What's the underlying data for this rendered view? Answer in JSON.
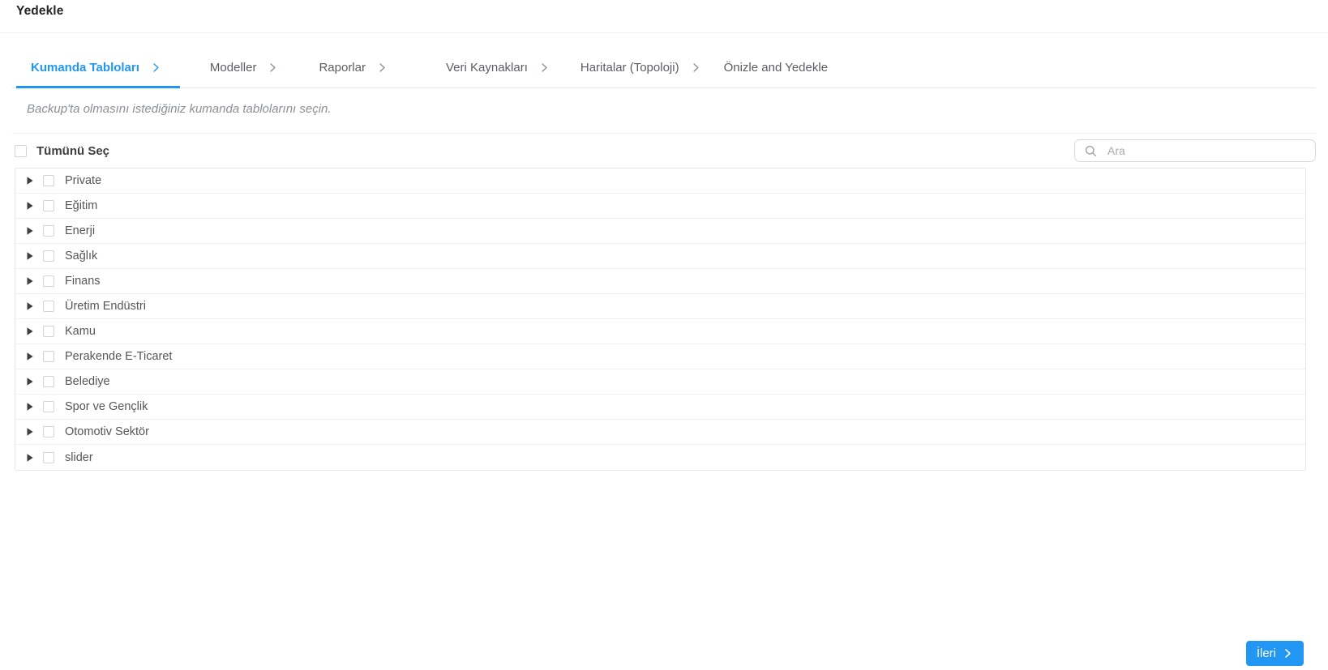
{
  "page": {
    "title": "Yedekle"
  },
  "wizard": {
    "tabs": [
      {
        "label": "Kumanda Tabloları",
        "active": true,
        "chevron": true
      },
      {
        "label": "Modeller",
        "active": false,
        "chevron": true
      },
      {
        "label": "Raporlar",
        "active": false,
        "chevron": true
      },
      {
        "label": "Veri Kaynakları",
        "active": false,
        "chevron": true
      },
      {
        "label": "Haritalar (Topoloji)",
        "active": false,
        "chevron": true
      },
      {
        "label": "Önizle and Yedekle",
        "active": false,
        "chevron": false
      }
    ]
  },
  "main": {
    "instruction": "Backup'ta olmasını istediğiniz kumanda tablolarını seçin.",
    "select_all_label": "Tümünü Seç",
    "select_all_checked": false,
    "search_placeholder": "Ara",
    "categories": [
      {
        "label": "Private",
        "checked": false,
        "expanded": false
      },
      {
        "label": "Eğitim",
        "checked": false,
        "expanded": false
      },
      {
        "label": "Enerji",
        "checked": false,
        "expanded": false
      },
      {
        "label": "Sağlık",
        "checked": false,
        "expanded": false
      },
      {
        "label": "Finans",
        "checked": false,
        "expanded": false
      },
      {
        "label": "Üretim Endüstri",
        "checked": false,
        "expanded": false
      },
      {
        "label": "Kamu",
        "checked": false,
        "expanded": false
      },
      {
        "label": "Perakende E-Ticaret",
        "checked": false,
        "expanded": false
      },
      {
        "label": "Belediye",
        "checked": false,
        "expanded": false
      },
      {
        "label": "Spor ve Gençlik",
        "checked": false,
        "expanded": false
      },
      {
        "label": "Otomotiv Sektör",
        "checked": false,
        "expanded": false
      },
      {
        "label": "slider",
        "checked": false,
        "expanded": false
      }
    ]
  },
  "footer": {
    "next_label": "İleri"
  },
  "icons": {
    "search": "search-icon",
    "tab_separator": "chevron-right-icon",
    "row_expand": "caret-right-icon",
    "next_button": "chevron-right-icon"
  },
  "colors": {
    "accent": "#2196f3",
    "tab_inactive_text": "#5a5e63",
    "tab_chevron_inactive": "#8a9097",
    "border": "#e8e8e8",
    "row_separator": "#efefef",
    "subtitle_text": "#8a8f94",
    "caret_fill": "#3e3e3e",
    "button_text": "#ffffff"
  }
}
